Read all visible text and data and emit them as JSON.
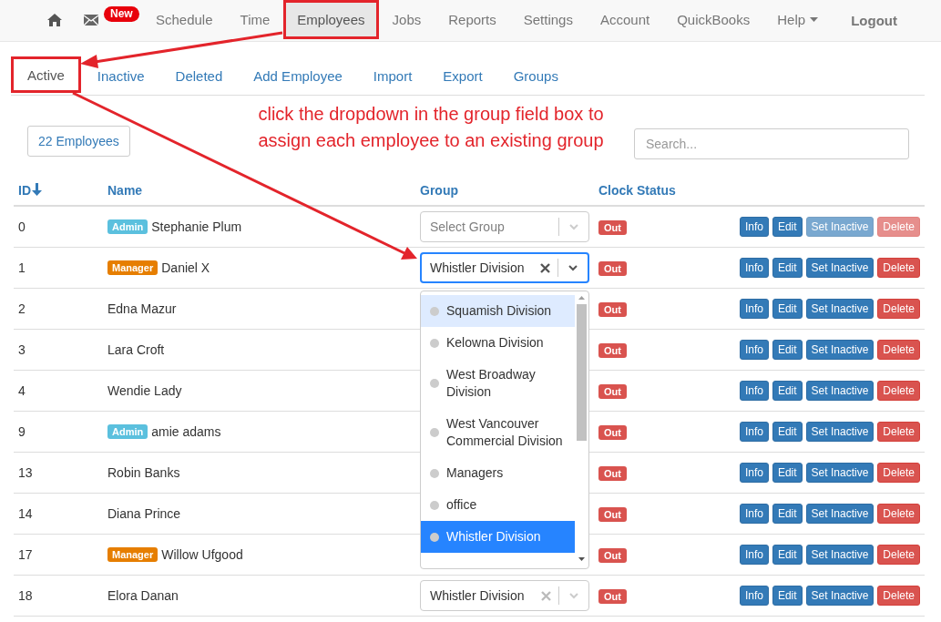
{
  "navbar": {
    "items": [
      {
        "kind": "home",
        "selected": false
      },
      {
        "kind": "mail",
        "badge": "New",
        "selected": false
      },
      {
        "kind": "link",
        "label": "Schedule",
        "selected": false
      },
      {
        "kind": "link",
        "label": "Time",
        "selected": false
      },
      {
        "kind": "link",
        "label": "Employees",
        "selected": true,
        "annotated": true
      },
      {
        "kind": "link",
        "label": "Jobs",
        "selected": false
      },
      {
        "kind": "link",
        "label": "Reports",
        "selected": false
      },
      {
        "kind": "link",
        "label": "Settings",
        "selected": false
      },
      {
        "kind": "link",
        "label": "Account",
        "selected": false
      },
      {
        "kind": "link",
        "label": "QuickBooks",
        "selected": false
      },
      {
        "kind": "link",
        "label": "Help",
        "dropdown": true,
        "selected": false
      }
    ],
    "logout": "Logout"
  },
  "tabs": [
    {
      "label": "Active",
      "selected": true,
      "annotated": true
    },
    {
      "label": "Inactive",
      "selected": false
    },
    {
      "label": "Deleted",
      "selected": false
    },
    {
      "label": "Add Employee",
      "selected": false
    },
    {
      "label": "Import",
      "selected": false
    },
    {
      "label": "Export",
      "selected": false
    },
    {
      "label": "Groups",
      "selected": false
    }
  ],
  "annotation": {
    "text": "click the dropdown in the group field box to assign each employee to an existing group"
  },
  "toolbar": {
    "count_button": "22 Employees",
    "search": {
      "placeholder": "Search..."
    }
  },
  "table": {
    "columns": [
      {
        "label": "ID",
        "sorted": true
      },
      {
        "label": "Name",
        "sorted": false
      },
      {
        "label": "Group",
        "sorted": false
      },
      {
        "label": "Clock Status",
        "sorted": false
      }
    ],
    "rows": [
      {
        "id": "0",
        "role": {
          "kind": "admin",
          "text": "Admin"
        },
        "name": "Stephanie Plum",
        "group": {
          "placeholder": "Select Group",
          "focused": false
        },
        "status": "Out",
        "actions": [
          {
            "kind": "primary",
            "label": "Info",
            "disabled": false
          },
          {
            "kind": "primary",
            "label": "Edit",
            "disabled": false
          },
          {
            "kind": "primary",
            "label": "Set Inactive",
            "disabled": true
          },
          {
            "kind": "danger",
            "label": "Delete",
            "disabled": true
          }
        ]
      },
      {
        "id": "1",
        "role": {
          "kind": "manager",
          "text": "Manager"
        },
        "name": "Daniel X",
        "group": {
          "value": "Whistler Division",
          "focused": true,
          "options": [
            {
              "label": "Squamish Division",
              "highlighted": true,
              "selected": false
            },
            {
              "label": "Kelowna Division",
              "highlighted": false,
              "selected": false
            },
            {
              "label": "West Broadway Division",
              "highlighted": false,
              "selected": false
            },
            {
              "label": "West Vancouver Commercial Division",
              "highlighted": false,
              "selected": false
            },
            {
              "label": "Managers",
              "highlighted": false,
              "selected": false
            },
            {
              "label": "office",
              "highlighted": false,
              "selected": false
            },
            {
              "label": "Whistler Division",
              "highlighted": false,
              "selected": true
            }
          ]
        },
        "status": "Out",
        "actions": [
          {
            "kind": "primary",
            "label": "Info",
            "disabled": false
          },
          {
            "kind": "primary",
            "label": "Edit",
            "disabled": false
          },
          {
            "kind": "primary",
            "label": "Set Inactive",
            "disabled": false
          },
          {
            "kind": "danger",
            "label": "Delete",
            "disabled": false
          }
        ]
      },
      {
        "id": "2",
        "name": "Edna Mazur",
        "status": "Out",
        "actions": [
          {
            "kind": "primary",
            "label": "Info",
            "disabled": false
          },
          {
            "kind": "primary",
            "label": "Edit",
            "disabled": false
          },
          {
            "kind": "primary",
            "label": "Set Inactive",
            "disabled": false
          },
          {
            "kind": "danger",
            "label": "Delete",
            "disabled": false
          }
        ]
      },
      {
        "id": "3",
        "name": "Lara Croft",
        "status": "Out",
        "actions": [
          {
            "kind": "primary",
            "label": "Info",
            "disabled": false
          },
          {
            "kind": "primary",
            "label": "Edit",
            "disabled": false
          },
          {
            "kind": "primary",
            "label": "Set Inactive",
            "disabled": false
          },
          {
            "kind": "danger",
            "label": "Delete",
            "disabled": false
          }
        ]
      },
      {
        "id": "4",
        "name": "Wendie Lady",
        "status": "Out",
        "actions": [
          {
            "kind": "primary",
            "label": "Info",
            "disabled": false
          },
          {
            "kind": "primary",
            "label": "Edit",
            "disabled": false
          },
          {
            "kind": "primary",
            "label": "Set Inactive",
            "disabled": false
          },
          {
            "kind": "danger",
            "label": "Delete",
            "disabled": false
          }
        ]
      },
      {
        "id": "9",
        "role": {
          "kind": "admin",
          "text": "Admin"
        },
        "name": "amie adams",
        "status": "Out",
        "actions": [
          {
            "kind": "primary",
            "label": "Info",
            "disabled": false
          },
          {
            "kind": "primary",
            "label": "Edit",
            "disabled": false
          },
          {
            "kind": "primary",
            "label": "Set Inactive",
            "disabled": false
          },
          {
            "kind": "danger",
            "label": "Delete",
            "disabled": false
          }
        ]
      },
      {
        "id": "13",
        "name": "Robin Banks",
        "status": "Out",
        "actions": [
          {
            "kind": "primary",
            "label": "Info",
            "disabled": false
          },
          {
            "kind": "primary",
            "label": "Edit",
            "disabled": false
          },
          {
            "kind": "primary",
            "label": "Set Inactive",
            "disabled": false
          },
          {
            "kind": "danger",
            "label": "Delete",
            "disabled": false
          }
        ]
      },
      {
        "id": "14",
        "name": "Diana Prince",
        "status": "Out",
        "actions": [
          {
            "kind": "primary",
            "label": "Info",
            "disabled": false
          },
          {
            "kind": "primary",
            "label": "Edit",
            "disabled": false
          },
          {
            "kind": "primary",
            "label": "Set Inactive",
            "disabled": false
          },
          {
            "kind": "danger",
            "label": "Delete",
            "disabled": false
          }
        ]
      },
      {
        "id": "17",
        "role": {
          "kind": "manager",
          "text": "Manager"
        },
        "name": "Willow Ufgood",
        "status": "Out",
        "actions": [
          {
            "kind": "primary",
            "label": "Info",
            "disabled": false
          },
          {
            "kind": "primary",
            "label": "Edit",
            "disabled": false
          },
          {
            "kind": "primary",
            "label": "Set Inactive",
            "disabled": false
          },
          {
            "kind": "danger",
            "label": "Delete",
            "disabled": false
          }
        ]
      },
      {
        "id": "18",
        "name": "Elora Danan",
        "group": {
          "value": "Whistler Division",
          "focused": false
        },
        "status": "Out",
        "actions": [
          {
            "kind": "primary",
            "label": "Info",
            "disabled": false
          },
          {
            "kind": "primary",
            "label": "Edit",
            "disabled": false
          },
          {
            "kind": "primary",
            "label": "Set Inactive",
            "disabled": false
          },
          {
            "kind": "danger",
            "label": "Delete",
            "disabled": false
          }
        ]
      }
    ]
  }
}
